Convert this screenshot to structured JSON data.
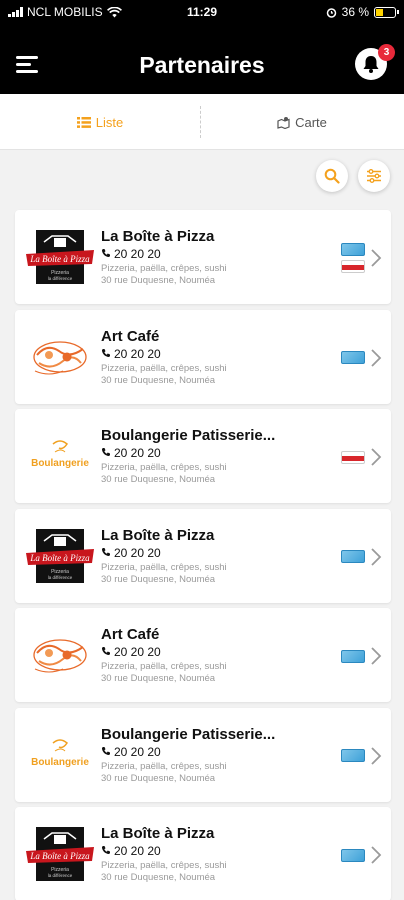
{
  "status_bar": {
    "carrier": "NCL MOBILIS",
    "time": "11:29",
    "battery": "36 %"
  },
  "header": {
    "title": "Partenaires",
    "notification_count": "3"
  },
  "tabs": [
    {
      "label": "Liste",
      "active": true,
      "icon": "list-icon"
    },
    {
      "label": "Carte",
      "active": false,
      "icon": "map-icon"
    }
  ],
  "colors": {
    "accent": "#f4a11d",
    "header_bg": "#000000",
    "badge": "#e8293a"
  },
  "partners": [
    {
      "name": "La Boîte à Pizza",
      "phone": "20 20 20",
      "description": "Pizzeria, paëlla, crêpes, sushi",
      "address": "30 rue Duquesne, Nouméa",
      "logo": "pizza-logo",
      "payment_cards": [
        "blue",
        "red"
      ]
    },
    {
      "name": "Art Café",
      "phone": "20 20 20",
      "description": "Pizzeria, paëlla, crêpes, sushi",
      "address": "30 rue Duquesne, Nouméa",
      "logo": "art-cafe-logo",
      "payment_cards": [
        "blue"
      ]
    },
    {
      "name": "Boulangerie Patisserie...",
      "phone": "20 20 20",
      "description": "Pizzeria, paëlla, crêpes, sushi",
      "address": "30 rue Duquesne, Nouméa",
      "logo": "boulangerie-logo",
      "payment_cards": [
        "red"
      ]
    },
    {
      "name": "La Boîte à Pizza",
      "phone": "20 20 20",
      "description": "Pizzeria, paëlla, crêpes, sushi",
      "address": "30 rue Duquesne, Nouméa",
      "logo": "pizza-logo",
      "payment_cards": [
        "blue"
      ]
    },
    {
      "name": "Art Café",
      "phone": "20 20 20",
      "description": "Pizzeria, paëlla, crêpes, sushi",
      "address": "30 rue Duquesne, Nouméa",
      "logo": "art-cafe-logo",
      "payment_cards": [
        "blue"
      ]
    },
    {
      "name": "Boulangerie Patisserie...",
      "phone": "20 20 20",
      "description": "Pizzeria, paëlla, crêpes, sushi",
      "address": "30 rue Duquesne, Nouméa",
      "logo": "boulangerie-logo",
      "payment_cards": [
        "blue"
      ]
    },
    {
      "name": "La Boîte à Pizza",
      "phone": "20 20 20",
      "description": "Pizzeria, paëlla, crêpes, sushi",
      "address": "30 rue Duquesne, Nouméa",
      "logo": "pizza-logo",
      "payment_cards": [
        "blue"
      ]
    }
  ],
  "logo_text": {
    "pizza_logo": [
      "La Boîte à Pizza",
      "Pizzeria",
      "la différence"
    ],
    "boulangerie_logo": [
      "Boulangerie"
    ]
  }
}
